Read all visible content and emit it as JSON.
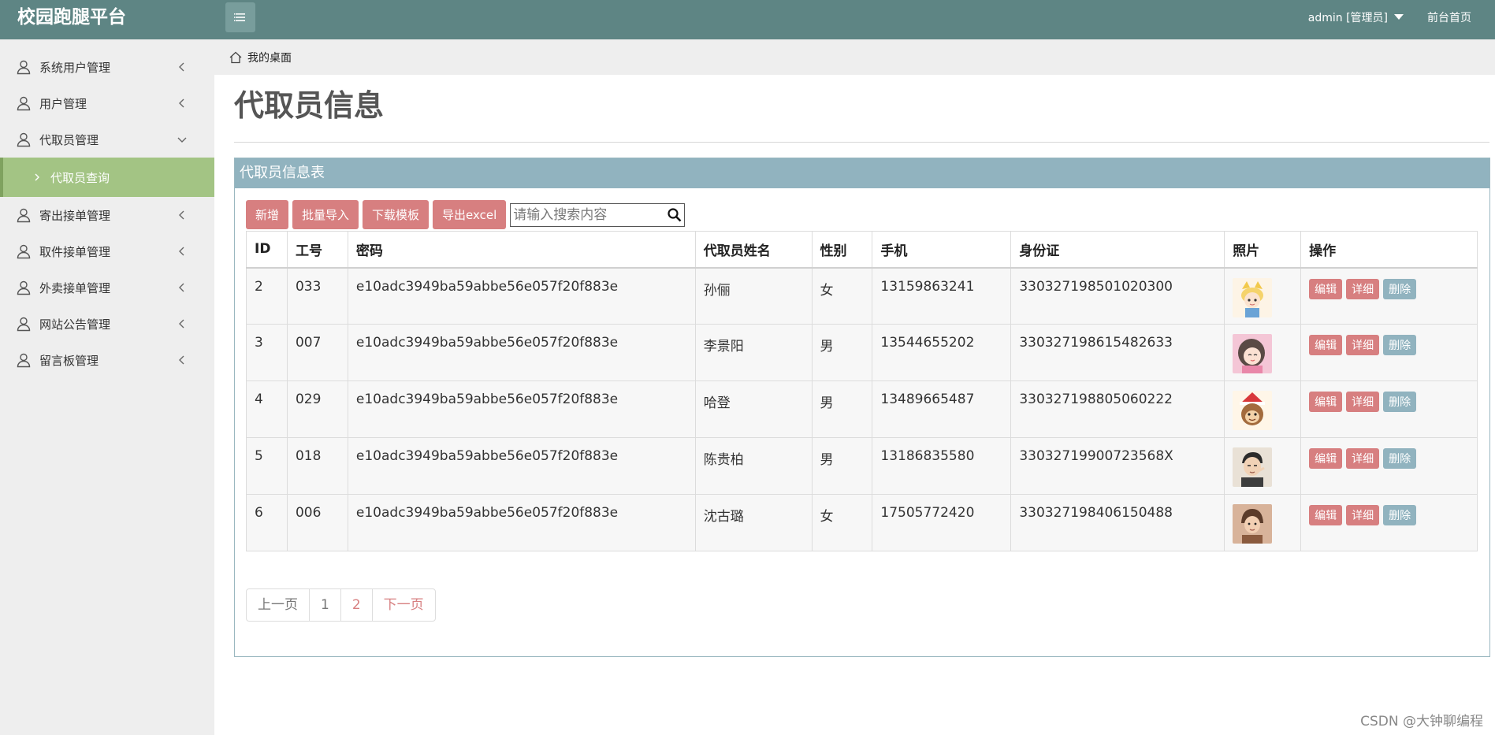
{
  "app": {
    "title": "校园跑腿平台"
  },
  "header": {
    "user": "admin [管理员]",
    "front_link": "前台首页"
  },
  "sidebar": {
    "items": [
      {
        "label": "系统用户管理"
      },
      {
        "label": "用户管理"
      },
      {
        "label": "代取员管理"
      },
      {
        "label": "寄出接单管理"
      },
      {
        "label": "取件接单管理"
      },
      {
        "label": "外卖接单管理"
      },
      {
        "label": "网站公告管理"
      },
      {
        "label": "留言板管理"
      }
    ],
    "active_sub": "代取员查询"
  },
  "breadcrumb": "我的桌面",
  "page": {
    "title": "代取员信息"
  },
  "panel": {
    "title": "代取员信息表",
    "buttons": {
      "add": "新增",
      "import": "批量导入",
      "template": "下载模板",
      "export": "导出excel"
    },
    "search_placeholder": "请输入搜索内容"
  },
  "table": {
    "headers": [
      "ID",
      "工号",
      "密码",
      "代取员姓名",
      "性别",
      "手机",
      "身份证",
      "照片",
      "操作"
    ],
    "rows": [
      {
        "id": "2",
        "no": "033",
        "pwd": "e10adc3949ba59abbe56e057f20f883e",
        "name": "孙俪",
        "gender": "女",
        "phone": "13159863241",
        "idcard": "330327198501020300"
      },
      {
        "id": "3",
        "no": "007",
        "pwd": "e10adc3949ba59abbe56e057f20f883e",
        "name": "李景阳",
        "gender": "男",
        "phone": "13544655202",
        "idcard": "330327198615482633"
      },
      {
        "id": "4",
        "no": "029",
        "pwd": "e10adc3949ba59abbe56e057f20f883e",
        "name": "哈登",
        "gender": "男",
        "phone": "13489665487",
        "idcard": "330327198805060222"
      },
      {
        "id": "5",
        "no": "018",
        "pwd": "e10adc3949ba59abbe56e057f20f883e",
        "name": "陈贵柏",
        "gender": "男",
        "phone": "13186835580",
        "idcard": "33032719900723568X"
      },
      {
        "id": "6",
        "no": "006",
        "pwd": "e10adc3949ba59abbe56e057f20f883e",
        "name": "沈古璐",
        "gender": "女",
        "phone": "17505772420",
        "idcard": "330327198406150488"
      }
    ],
    "ops": {
      "edit": "编辑",
      "detail": "详细",
      "delete": "删除"
    }
  },
  "pager": {
    "prev": "上一页",
    "p1": "1",
    "p2": "2",
    "next": "下一页"
  },
  "watermark": "CSDN @大钟聊编程",
  "colors": {
    "topbar": "#5e8584",
    "accent_green": "#a3c484",
    "btn_red": "#d77f80",
    "panel_head": "#91b3bf"
  }
}
